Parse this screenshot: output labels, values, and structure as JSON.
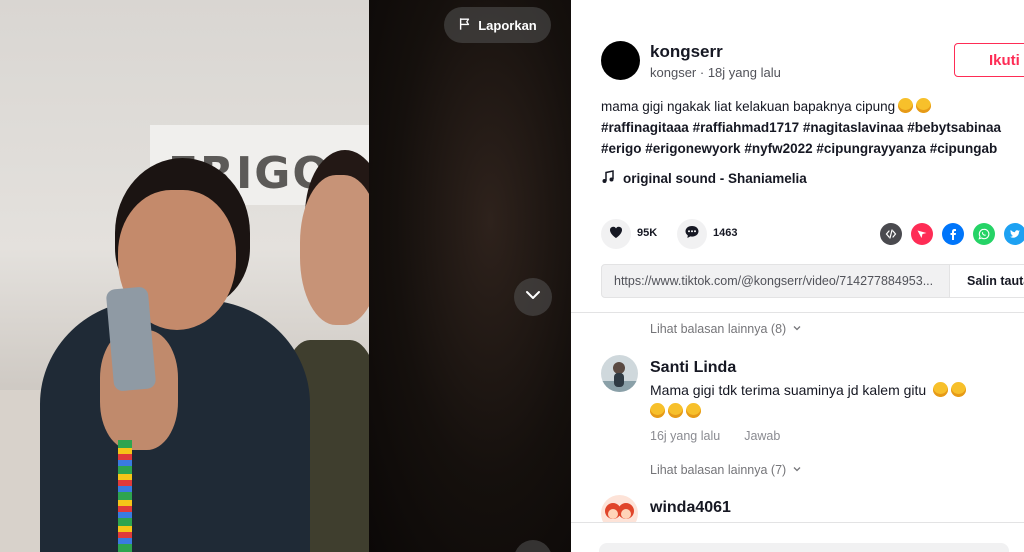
{
  "video": {
    "report_label": "Laporkan",
    "backdrop_brand_text": "ERIGO X"
  },
  "author": {
    "username": "kongserr",
    "nickname": "kongser",
    "posted": "18j yang lalu",
    "follow_label": "Ikuti"
  },
  "caption": {
    "text": "mama gigi ngakak liat kelakuan bapaknya cipung",
    "emojis": [
      "rolling-on-floor-laughing",
      "rolling-on-floor-laughing"
    ],
    "hashtags_line1": [
      "#raffinagitaaa",
      "#raffiahmad1717",
      "#nagitaslavinaa",
      "#bebytsabinaa"
    ],
    "hashtags_line2": [
      "#erigo",
      "#erigonewyork",
      "#nyfw2022",
      "#cipungrayyanza",
      "#cipungab"
    ]
  },
  "sound": {
    "label": "original sound - Shaniamelia"
  },
  "stats": {
    "likes": "95K",
    "comments": "1463"
  },
  "share": {
    "icons": [
      "embed-icon",
      "send-to-friends-icon",
      "facebook-icon",
      "whatsapp-icon",
      "twitter-icon"
    ],
    "colors": {
      "embed": "#4a4a4f",
      "send": "#fe2c55",
      "facebook": "#0075fa",
      "whatsapp": "#25d366",
      "twitter": "#1da1f2"
    }
  },
  "link": {
    "url": "https://www.tiktok.com/@kongserr/video/714277884953...",
    "copy_label": "Salin tauta"
  },
  "comments": {
    "view_more_1": "Lihat balasan lainnya (8)",
    "items": [
      {
        "username": "Santi Linda",
        "text": "Mama gigi tdk terima suaminya jd kalem gitu",
        "emoji_count": 5,
        "posted": "16j yang lalu",
        "reply_label": "Jawab"
      },
      {
        "username": "winda4061"
      }
    ],
    "view_more_2": "Lihat balasan lainnya (7)"
  },
  "theme": {
    "accent": "#fe2c55",
    "text": "#161823",
    "muted": "#757579"
  }
}
